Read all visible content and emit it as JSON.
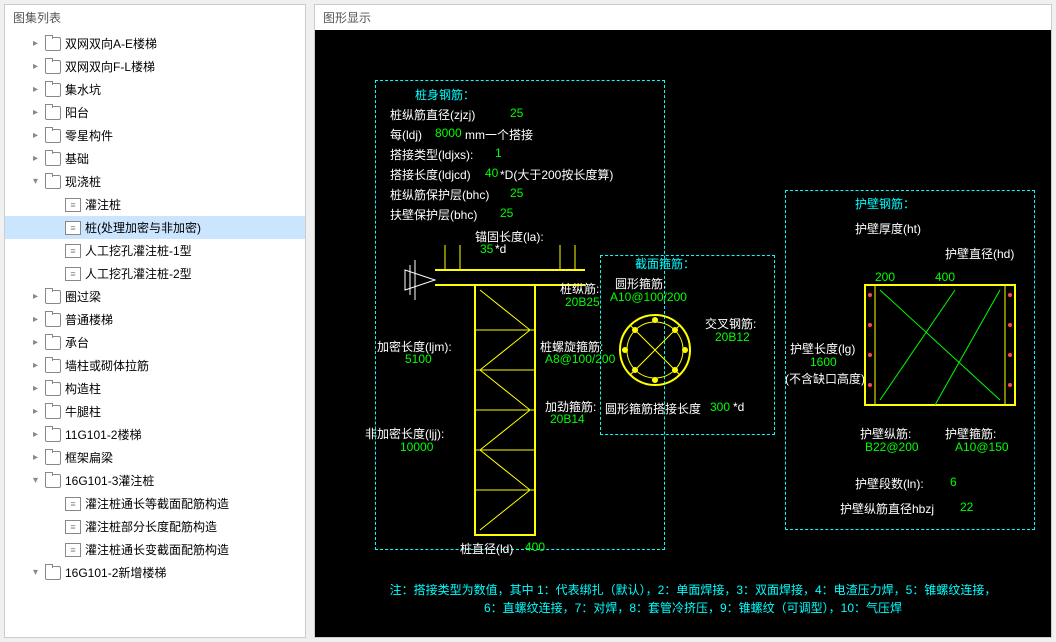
{
  "treeTitle": "图集列表",
  "viewerTitle": "图形显示",
  "tree": [
    {
      "d": 1,
      "a": "▸",
      "t": "f",
      "l": "双网双向A-E楼梯"
    },
    {
      "d": 1,
      "a": "▸",
      "t": "f",
      "l": "双网双向F-L楼梯"
    },
    {
      "d": 1,
      "a": "▸",
      "t": "f",
      "l": "集水坑"
    },
    {
      "d": 1,
      "a": "▸",
      "t": "f",
      "l": "阳台"
    },
    {
      "d": 1,
      "a": "▸",
      "t": "f",
      "l": "零星构件"
    },
    {
      "d": 1,
      "a": "▸",
      "t": "f",
      "l": "基础"
    },
    {
      "d": 1,
      "a": "▾",
      "t": "f",
      "l": "现浇桩"
    },
    {
      "d": 2,
      "a": "",
      "t": "d",
      "l": "灌注桩"
    },
    {
      "d": 2,
      "a": "",
      "t": "d",
      "l": "桩(处理加密与非加密)",
      "sel": true
    },
    {
      "d": 2,
      "a": "",
      "t": "d",
      "l": "人工挖孔灌注桩-1型"
    },
    {
      "d": 2,
      "a": "",
      "t": "d",
      "l": "人工挖孔灌注桩-2型"
    },
    {
      "d": 1,
      "a": "▸",
      "t": "f",
      "l": "圈过梁"
    },
    {
      "d": 1,
      "a": "▸",
      "t": "f",
      "l": "普通楼梯"
    },
    {
      "d": 1,
      "a": "▸",
      "t": "f",
      "l": "承台"
    },
    {
      "d": 1,
      "a": "▸",
      "t": "f",
      "l": "墙柱或砌体拉筋"
    },
    {
      "d": 1,
      "a": "▸",
      "t": "f",
      "l": "构造柱"
    },
    {
      "d": 1,
      "a": "▸",
      "t": "f",
      "l": "牛腿柱"
    },
    {
      "d": 1,
      "a": "▸",
      "t": "f",
      "l": "11G101-2楼梯"
    },
    {
      "d": 1,
      "a": "▸",
      "t": "f",
      "l": "框架扁梁"
    },
    {
      "d": 1,
      "a": "▾",
      "t": "f",
      "l": "16G101-3灌注桩"
    },
    {
      "d": 2,
      "a": "",
      "t": "d",
      "l": "灌注桩通长等截面配筋构造"
    },
    {
      "d": 2,
      "a": "",
      "t": "d",
      "l": "灌注桩部分长度配筋构造"
    },
    {
      "d": 2,
      "a": "",
      "t": "d",
      "l": "灌注桩通长变截面配筋构造"
    },
    {
      "d": 1,
      "a": "▾",
      "t": "f",
      "l": "16G101-2新增楼梯"
    }
  ],
  "sec1": {
    "title": "桩身钢筋：",
    "l1a": "桩纵筋直径(zjzj)",
    "l1b": "25",
    "l2a": "每(ldj)",
    "l2b": "8000",
    "l2c": " mm一个搭接",
    "l3a": "搭接类型(ldjxs):",
    "l3b": "1",
    "l4a": "搭接长度(ldjcd)",
    "l4b": "40",
    "l4c": "*D(大于200按长度算)",
    "l5a": "桩纵筋保护层(bhc)",
    "l5b": "25",
    "l6a": "扶壁保护层(bhc)",
    "l6b": "25"
  },
  "pile": {
    "anchor_t": "锚固长度(la):",
    "anchor_v": "35",
    "anchor_s": "*d",
    "vbar_t": "桩纵筋:",
    "vbar_v": "20B25",
    "dense_t": "加密长度(ljm):",
    "dense_v": "5100",
    "spiral_t": "桩螺旋箍筋:",
    "spiral_v": "A8@100/200",
    "stiff_t": "加劲箍筋:",
    "stiff_v": "20B14",
    "nondense_t": "非加密长度(ljj):",
    "nondense_v": "10000",
    "dia_t": "桩直径(ld)",
    "dia_v": "400"
  },
  "cross": {
    "title": "截面箍筋：",
    "circ_t": "圆形箍筋:",
    "circ_v": "A10@100/200",
    "x_t": "交叉钢筋:",
    "x_v": "20B12",
    "lap_t": "圆形箍筋搭接长度",
    "lap_v": "300",
    "lap_s": "*d"
  },
  "wall": {
    "title": "护壁钢筋：",
    "thk_t": "护壁厚度(ht)",
    "dia_t": "护壁直径(hd)",
    "dia_v1": "200",
    "dia_v2": "400",
    "len_t": "护壁长度(lg)",
    "len_v": "1600",
    "len_s": "(不含缺口高度)",
    "vbar_t": "护壁纵筋:",
    "vbar_v": "B22@200",
    "hoop_t": "护壁箍筋:",
    "hoop_v": "A10@150",
    "seg_t": "护壁段数(ln):",
    "seg_v": "6",
    "vdia_t": "护壁纵筋直径hbzj",
    "vdia_v": "22"
  },
  "note1": "注：搭接类型为数值，其中 1：代表绑扎（默认），2：单面焊接，3：双面焊接，4：电渣压力焊，5：锥螺纹连接，",
  "note2": "6：直螺纹连接，7：对焊，8：套管冷挤压，9：锥螺纹（可调型），10：气压焊"
}
